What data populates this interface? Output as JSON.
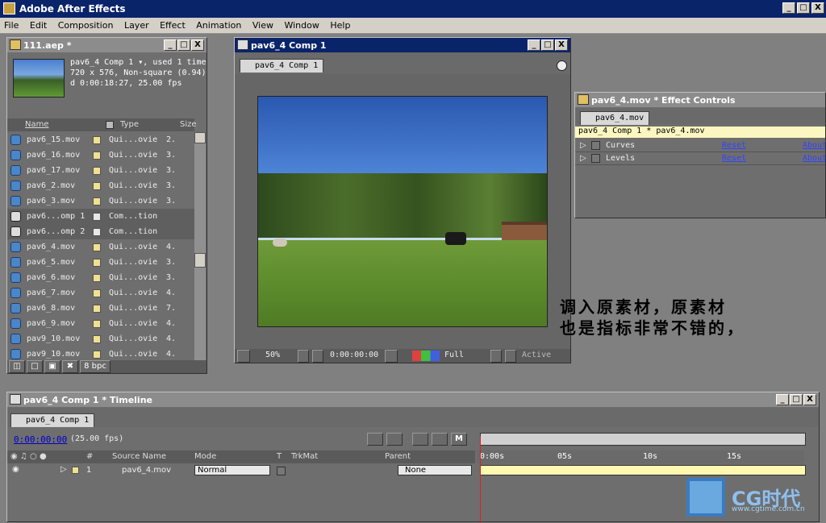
{
  "app": {
    "title": "Adobe After Effects",
    "min": "_",
    "max": "□",
    "close": "X"
  },
  "menu": [
    "File",
    "Edit",
    "Composition",
    "Layer",
    "Effect",
    "Animation",
    "View",
    "Window",
    "Help"
  ],
  "project": {
    "title": "111.aep *",
    "info_line1": "pav6_4 Comp 1 ▾, used 1 time",
    "info_line2": "720 x 576, Non-square (0.94)",
    "info_line3": "d 0:00:18:27, 25.00 fps",
    "col_name": "Name",
    "col_type": "Type",
    "col_size": "Size",
    "items": [
      {
        "name": "pav6_15.mov",
        "type": "Qui...ovie",
        "size": "2.",
        "kind": "mov"
      },
      {
        "name": "pav6_16.mov",
        "type": "Qui...ovie",
        "size": "3.",
        "kind": "mov"
      },
      {
        "name": "pav6_17.mov",
        "type": "Qui...ovie",
        "size": "3.",
        "kind": "mov"
      },
      {
        "name": "pav6_2.mov",
        "type": "Qui...ovie",
        "size": "3.",
        "kind": "mov"
      },
      {
        "name": "pav6_3.mov",
        "type": "Qui...ovie",
        "size": "3.",
        "kind": "mov"
      },
      {
        "name": "pav6...omp 1",
        "type": "Com...tion",
        "size": "",
        "kind": "comp"
      },
      {
        "name": "pav6...omp 2",
        "type": "Com...tion",
        "size": "",
        "kind": "comp"
      },
      {
        "name": "pav6_4.mov",
        "type": "Qui...ovie",
        "size": "4.",
        "kind": "mov"
      },
      {
        "name": "pav6_5.mov",
        "type": "Qui...ovie",
        "size": "3.",
        "kind": "mov"
      },
      {
        "name": "pav6_6.mov",
        "type": "Qui...ovie",
        "size": "3.",
        "kind": "mov"
      },
      {
        "name": "pav6_7.mov",
        "type": "Qui...ovie",
        "size": "4.",
        "kind": "mov"
      },
      {
        "name": "pav6_8.mov",
        "type": "Qui...ovie",
        "size": "7.",
        "kind": "mov"
      },
      {
        "name": "pav6_9.mov",
        "type": "Qui...ovie",
        "size": "4.",
        "kind": "mov"
      },
      {
        "name": "pav9_10.mov",
        "type": "Qui...ovie",
        "size": "4.",
        "kind": "mov"
      },
      {
        "name": "pav9_10.mov",
        "type": "Qui...ovie",
        "size": "4.",
        "kind": "mov"
      }
    ],
    "bpc": "8 bpc"
  },
  "comp": {
    "title": "pav6_4 Comp 1",
    "tab": "pav6_4 Comp 1",
    "zoom": "50%",
    "timecode": "0:00:00:00",
    "resolution": "Full",
    "view": "Active"
  },
  "effects": {
    "title": "pav6_4.mov * Effect Controls",
    "tab": "pav6_4.mov",
    "header": "pav6_4 Comp 1 * pav6_4.mov",
    "items": [
      {
        "name": "Curves",
        "reset": "Reset",
        "about": "About"
      },
      {
        "name": "Levels",
        "reset": "Reset",
        "about": "About"
      }
    ]
  },
  "timeline": {
    "title": "pav6_4 Comp 1 * Timeline",
    "tab": "pav6_4 Comp 1",
    "timecode": "0:00:00:00",
    "fps": "(25.00 fps)",
    "col_num": "#",
    "col_source": "Source Name",
    "col_mode": "Mode",
    "col_t": "T",
    "col_trkmat": "TrkMat",
    "col_parent": "Parent",
    "ruler": [
      "0:00s",
      "05s",
      "10s",
      "15s"
    ],
    "layer": {
      "num": "1",
      "name": "pav6_4.mov",
      "mode": "Normal",
      "parent": "None"
    },
    "m_btn": "M"
  },
  "annotation": {
    "line1": "调入原素材，原素材",
    "line2": "也是指标非常不错的，"
  },
  "watermark": {
    "brand": "CG时代",
    "url": "www.cgtime.com.cn"
  }
}
